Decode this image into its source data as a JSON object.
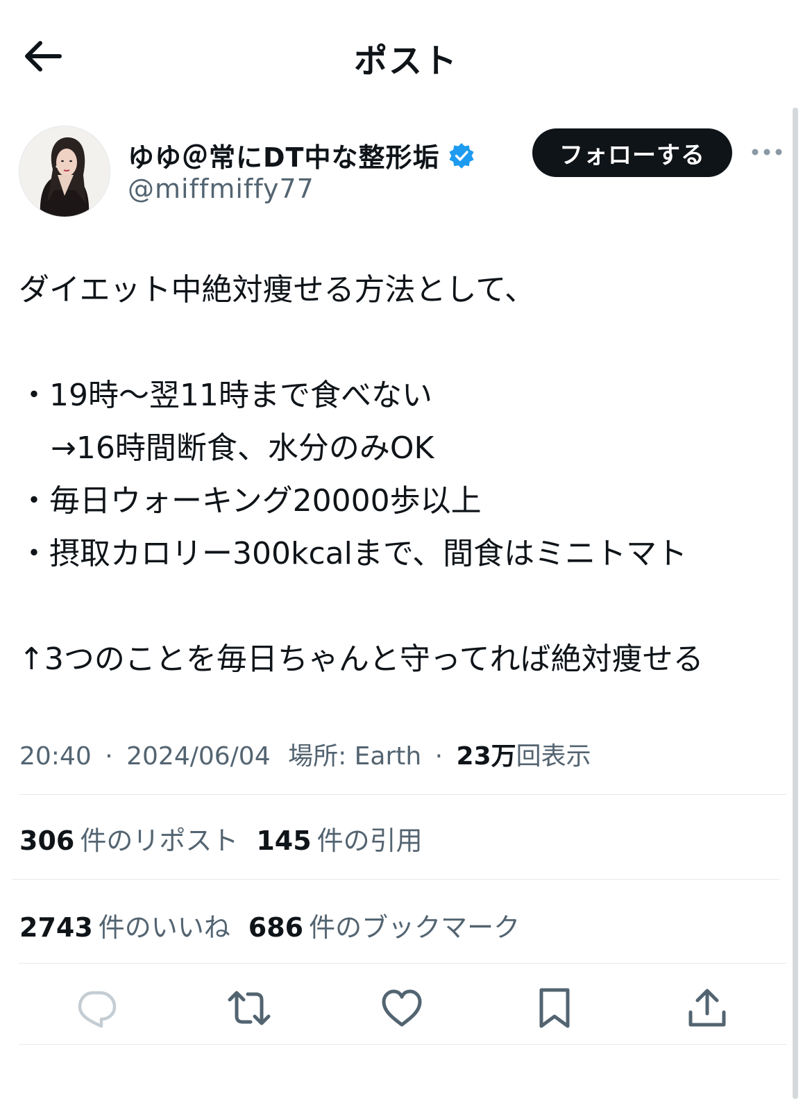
{
  "header": {
    "title": "ポスト"
  },
  "author": {
    "display_name": "ゆゆ＠常にDT中な整形垢",
    "handle": "@miffmiffy77",
    "follow_label": "フォローする"
  },
  "tweet": {
    "lines": [
      "ダイエット中絶対痩せる方法として、",
      "",
      "・19時〜翌11時まで食べない",
      "→16時間断食、水分のみOK",
      "・毎日ウォーキング20000歩以上",
      "・摂取カロリー300kcalまで、間食はミニトマト",
      "",
      "↑3つのことを毎日ちゃんと守ってれば絶対痩せる"
    ]
  },
  "meta": {
    "time": "20:40",
    "date": "2024/06/04",
    "location": "場所: Earth",
    "views_count": "23万",
    "views_label": "回表示"
  },
  "stats": {
    "reposts_count": "306",
    "reposts_label": "件のリポスト",
    "quotes_count": "145",
    "quotes_label": "件の引用",
    "likes_count": "2743",
    "likes_label": "件のいいね",
    "bookmarks_count": "686",
    "bookmarks_label": "件のブックマーク"
  },
  "icons": {
    "back": "arrow-left-icon",
    "verified": "verified-badge-icon",
    "more": "more-horizontal-icon",
    "reply": "reply-icon",
    "repost": "repost-icon",
    "like": "heart-icon",
    "bookmark": "bookmark-icon",
    "share": "share-icon"
  },
  "colors": {
    "text": "#0f1419",
    "secondary": "#536471",
    "verified": "#1d9bf0",
    "divider": "#e6e9eb"
  }
}
